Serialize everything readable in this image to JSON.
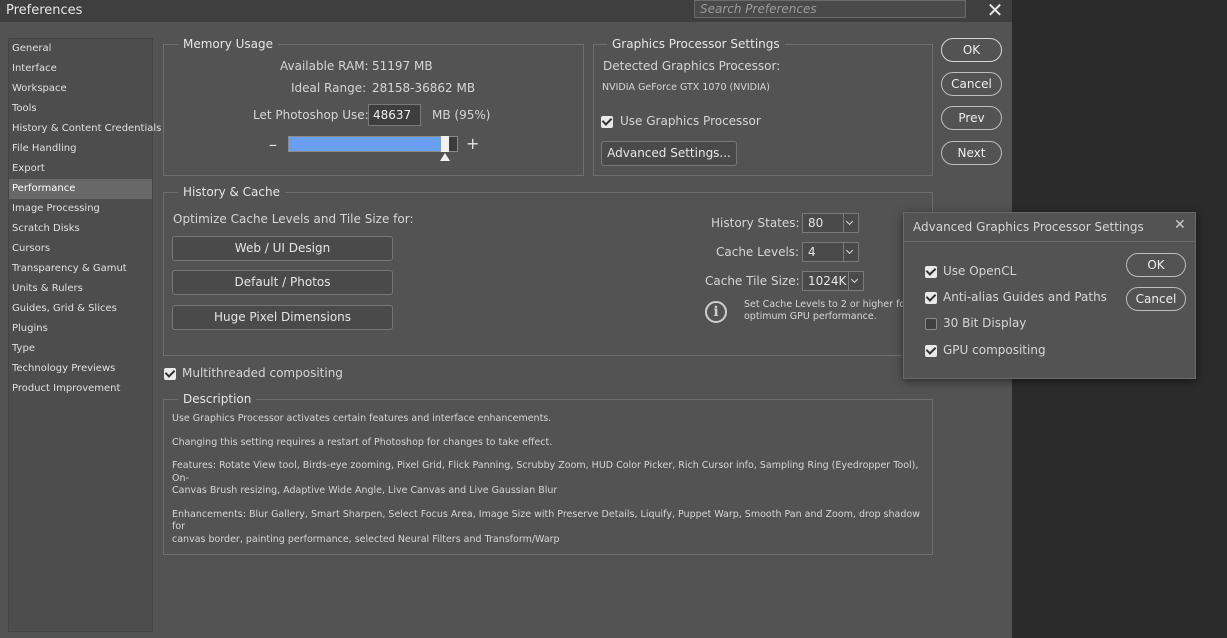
{
  "window": {
    "title": "Preferences",
    "search_placeholder": "Search Preferences",
    "close": "✕"
  },
  "sidebar": {
    "items": [
      {
        "label": "General"
      },
      {
        "label": "Interface"
      },
      {
        "label": "Workspace"
      },
      {
        "label": "Tools"
      },
      {
        "label": "History & Content Credentials"
      },
      {
        "label": "File Handling"
      },
      {
        "label": "Export"
      },
      {
        "label": "Performance",
        "active": true
      },
      {
        "label": "Image Processing"
      },
      {
        "label": "Scratch Disks"
      },
      {
        "label": "Cursors"
      },
      {
        "label": "Transparency & Gamut"
      },
      {
        "label": "Units & Rulers"
      },
      {
        "label": "Guides, Grid & Slices"
      },
      {
        "label": "Plugins"
      },
      {
        "label": "Type"
      },
      {
        "label": "Technology Previews"
      },
      {
        "label": "Product Improvement"
      }
    ]
  },
  "memory": {
    "title": "Memory Usage",
    "available_label": "Available RAM:",
    "available_value": "51197 MB",
    "ideal_label": "Ideal Range:",
    "ideal_value": "28158-36862 MB",
    "use_label": "Let Photoshop Use:",
    "use_value": "48637",
    "use_unit": "MB (95%)",
    "minus": "–",
    "plus": "+",
    "slider_percent": 95
  },
  "gpu": {
    "title": "Graphics Processor Settings",
    "detected_label": "Detected Graphics Processor:",
    "detected_value": "NVIDIA GeForce GTX 1070 (NVIDIA)",
    "use_gpu_label": "Use Graphics Processor",
    "use_gpu_checked": true,
    "advanced_button": "Advanced Settings..."
  },
  "buttons": {
    "ok": "OK",
    "cancel": "Cancel",
    "prev": "Prev",
    "next": "Next"
  },
  "history_cache": {
    "title": "History & Cache",
    "optimize_label": "Optimize Cache Levels and Tile Size for:",
    "presets": [
      "Web / UI Design",
      "Default / Photos",
      "Huge Pixel Dimensions"
    ],
    "history_states_label": "History States:",
    "history_states_value": "80",
    "cache_levels_label": "Cache Levels:",
    "cache_levels_value": "4",
    "cache_tile_label": "Cache Tile Size:",
    "cache_tile_value": "1024K",
    "info_text_1": "Set Cache Levels to 2 or higher for",
    "info_text_2": "optimum GPU performance."
  },
  "multithreaded": {
    "label": "Multithreaded compositing",
    "checked": true
  },
  "description": {
    "title": "Description",
    "p1": "Use Graphics Processor activates certain features and interface enhancements.",
    "p2": "Changing this setting requires a restart of Photoshop for changes to take effect.",
    "p3a": "Features: Rotate View tool, Birds-eye zooming, Pixel Grid, Flick Panning, Scrubby Zoom, HUD Color Picker, Rich Cursor info, Sampling Ring (Eyedropper Tool), On-",
    "p3b": "Canvas Brush resizing, Adaptive Wide Angle, Live Canvas and Live Gaussian Blur",
    "p4a": "Enhancements: Blur Gallery, Smart Sharpen, Select Focus Area, Image Size with Preserve Details, Liquify, Puppet Warp, Smooth Pan and Zoom, drop shadow for",
    "p4b": "canvas border, painting performance, selected Neural Filters and Transform/Warp"
  },
  "advanced_dialog": {
    "title": "Advanced Graphics Processor Settings",
    "close": "✕",
    "options": [
      {
        "label": "Use OpenCL",
        "checked": true
      },
      {
        "label": "Anti-alias Guides and Paths",
        "checked": true
      },
      {
        "label": "30 Bit Display",
        "checked": false
      },
      {
        "label": "GPU compositing",
        "checked": true
      }
    ],
    "ok": "OK",
    "cancel": "Cancel"
  },
  "colors": {
    "slider_fill": "#6a9ff0",
    "panel_bg": "#535353",
    "sidebar_active": "#686868"
  }
}
